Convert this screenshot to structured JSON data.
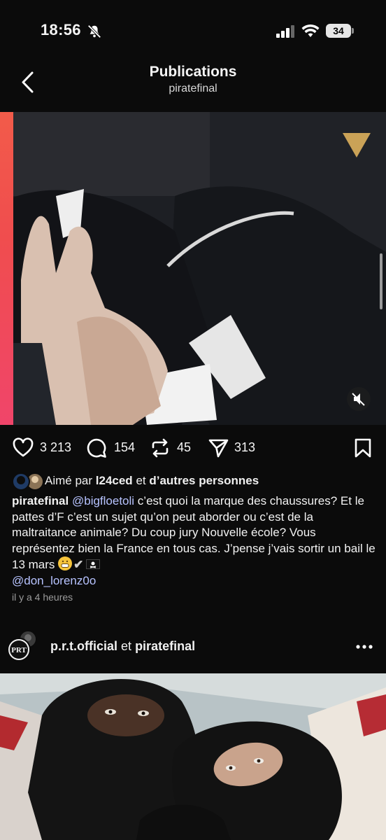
{
  "status_bar": {
    "time": "18:56",
    "battery": "34"
  },
  "header": {
    "title": "Publications",
    "subtitle": "piratefinal"
  },
  "post1": {
    "actions": {
      "likes": "3 213",
      "comments": "154",
      "reposts": "45",
      "shares": "313"
    },
    "liked_by": {
      "prefix": "Aimé par",
      "user": "l24ced",
      "conj": "et",
      "others": "d’autres personnes"
    },
    "caption": {
      "author": "piratefinal",
      "mention1": "@bigfloetoli",
      "text": " c’est quoi la marque des chaussures? Et le pattes d’F c’est un sujet qu’on peut aborder ou c’est de la maltraitance animale? Du coup jury Nouvelle école? Vous représentez bien la France en tous cas. J’pense j’vais sortir un bail le 13 mars ",
      "mention2": "@don_lorenz0o"
    },
    "time_ago": "il y a 4 heures"
  },
  "post2": {
    "user1": "p.r.t.official",
    "conj": "et",
    "user2": "piratefinal"
  },
  "colors": {
    "background": "#0b0b0b",
    "mention": "#b7c3ff",
    "story_stripe": "#f25b4a"
  }
}
